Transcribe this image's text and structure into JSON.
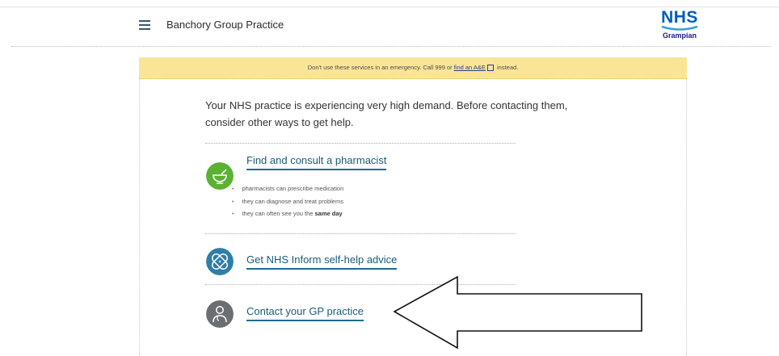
{
  "header": {
    "practice_name": "Banchory Group Practice",
    "logo_title": "NHS",
    "logo_subtitle": "Grampian"
  },
  "banner": {
    "text_before": "Don't use these services in an emergency. Call 999 or ",
    "link": "find an A&E",
    "text_after": " instead."
  },
  "intro": "Your NHS practice is experiencing very high demand. Before contacting them, consider other ways to get help.",
  "options": [
    {
      "label": "Find and consult a pharmacist",
      "icon": "pharmacy-mortar-icon",
      "color": "#5ab132",
      "bullets": [
        {
          "text": "pharmacists can prescribe medication",
          "bold": ""
        },
        {
          "text": "they can diagnose and treat problems",
          "bold": ""
        },
        {
          "text": "they can often see you the ",
          "bold": "same day"
        }
      ]
    },
    {
      "label": "Get NHS Inform self-help advice",
      "icon": "bandage-plaster-icon",
      "color": "#2f7ea8"
    },
    {
      "label": "Contact your GP practice",
      "icon": "doctor-icon",
      "color": "#6b6e72"
    }
  ]
}
